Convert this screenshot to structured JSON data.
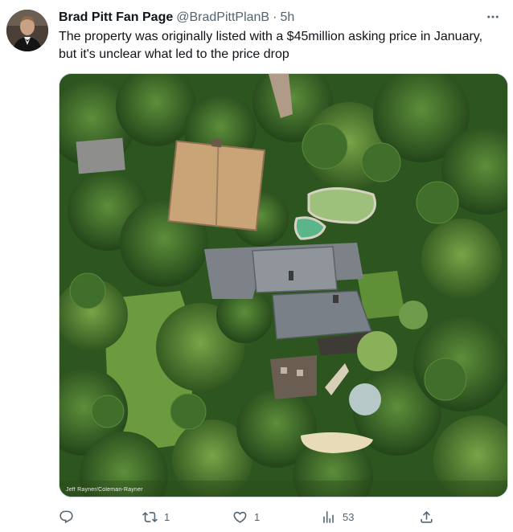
{
  "tweet": {
    "author": {
      "display_name": "Brad Pitt Fan Page",
      "handle": "@BradPittPlanB",
      "separator": "·",
      "time": "5h",
      "avatar_icon": "avatar-photo"
    },
    "more_icon": "ellipsis-icon",
    "text": "The property was originally listed with a $45million asking price in January, but it's unclear what led to the price drop",
    "media": {
      "description_type": "aerial-photo",
      "credit": "Jeff Rayner/Coleman-Rayner"
    },
    "actions": {
      "reply": {
        "icon": "reply-icon",
        "count": ""
      },
      "retweet": {
        "icon": "retweet-icon",
        "count": "1"
      },
      "like": {
        "icon": "heart-icon",
        "count": "1"
      },
      "views": {
        "icon": "views-icon",
        "count": "53"
      },
      "share": {
        "icon": "share-icon"
      }
    }
  },
  "colors": {
    "text_primary": "#0f1419",
    "text_secondary": "#536471",
    "border": "#cfd9de"
  }
}
